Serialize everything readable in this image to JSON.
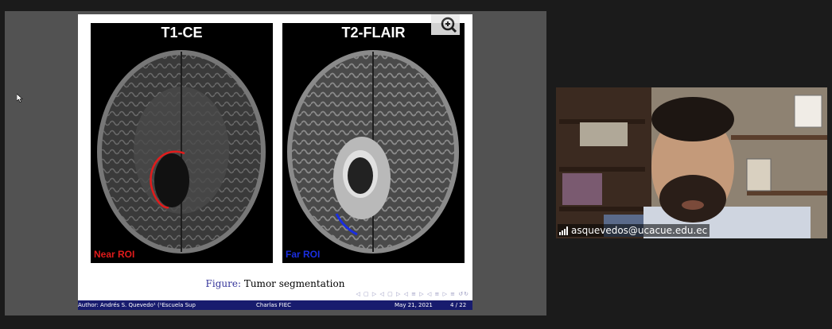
{
  "slide": {
    "panel_left_title": "T1-CE",
    "panel_right_title": "T2-FLAIR",
    "near_roi": "Near ROI",
    "far_roi": "Far ROI",
    "caption_label": "Figure:",
    "caption_text": "Tumor segmentation",
    "footer": {
      "author": "Author: Andrés S. Quevedo¹  (¹Escuela Sup",
      "title": "Charlas FIEC",
      "date": "May 21, 2021",
      "page": "4 / 22"
    },
    "nav_symbols": "◁ ▢ ▷ ◁ ▢ ▷ ◁ ≡ ▷ ◁ ≡ ▷   ≡   ↺↻"
  },
  "icons": {
    "zoom": "magnifier-plus-icon",
    "cursor": "mouse-pointer-icon",
    "signal": "signal-bars-icon"
  },
  "colors": {
    "near_roi": "#e11b1b",
    "far_roi": "#1a2ee0",
    "footer_bg": "#181c6e",
    "caption_figure": "#333399"
  },
  "video": {
    "participant_name": "asquevedos@ucacue.edu.ec"
  }
}
